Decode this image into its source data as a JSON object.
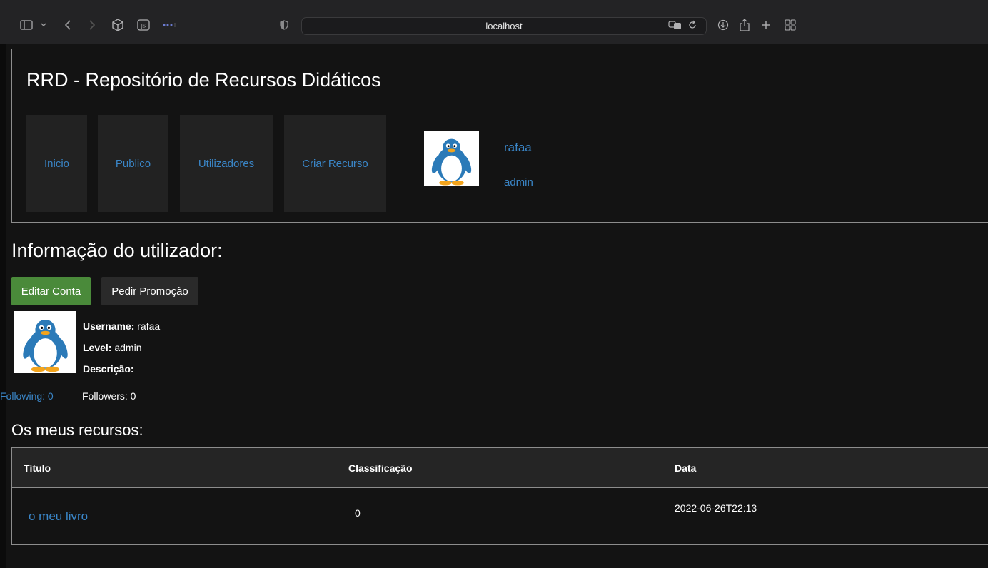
{
  "browser": {
    "url": "localhost",
    "icons": [
      "sidebar-icon",
      "chevron-down-icon",
      "back-icon",
      "forward-icon",
      "cube-icon",
      "js-icon",
      "more-icon",
      "shield-icon",
      "translate-icon",
      "reload-icon",
      "download-icon",
      "share-icon",
      "new-tab-icon",
      "tabs-grid-icon"
    ]
  },
  "header": {
    "title": "RRD - Repositório de Recursos Didáticos",
    "nav": [
      {
        "label": "Inicio"
      },
      {
        "label": "Publico"
      },
      {
        "label": "Utilizadores"
      },
      {
        "label": "Criar Recurso"
      }
    ],
    "user": {
      "name": "rafaa",
      "level": "admin"
    }
  },
  "profile": {
    "section_title": "Informação do utilizador:",
    "edit_button": "Editar Conta",
    "promo_button": "Pedir Promoção",
    "username_label": "Username:",
    "username_value": "rafaa",
    "level_label": "Level:",
    "level_value": "admin",
    "description_label": "Descrição:",
    "following": "Following: 0",
    "followers": "Followers: 0"
  },
  "resources": {
    "section_title": "Os meus recursos:",
    "columns": [
      "Título",
      "Classificação",
      "Data"
    ],
    "rows": [
      {
        "title": "o meu livro",
        "rating": "0",
        "date": "2022-06-26T22:13"
      }
    ]
  },
  "colors": {
    "link": "#3a86c8",
    "edit_button": "#4a8a3a",
    "nav_bg": "#222222"
  }
}
